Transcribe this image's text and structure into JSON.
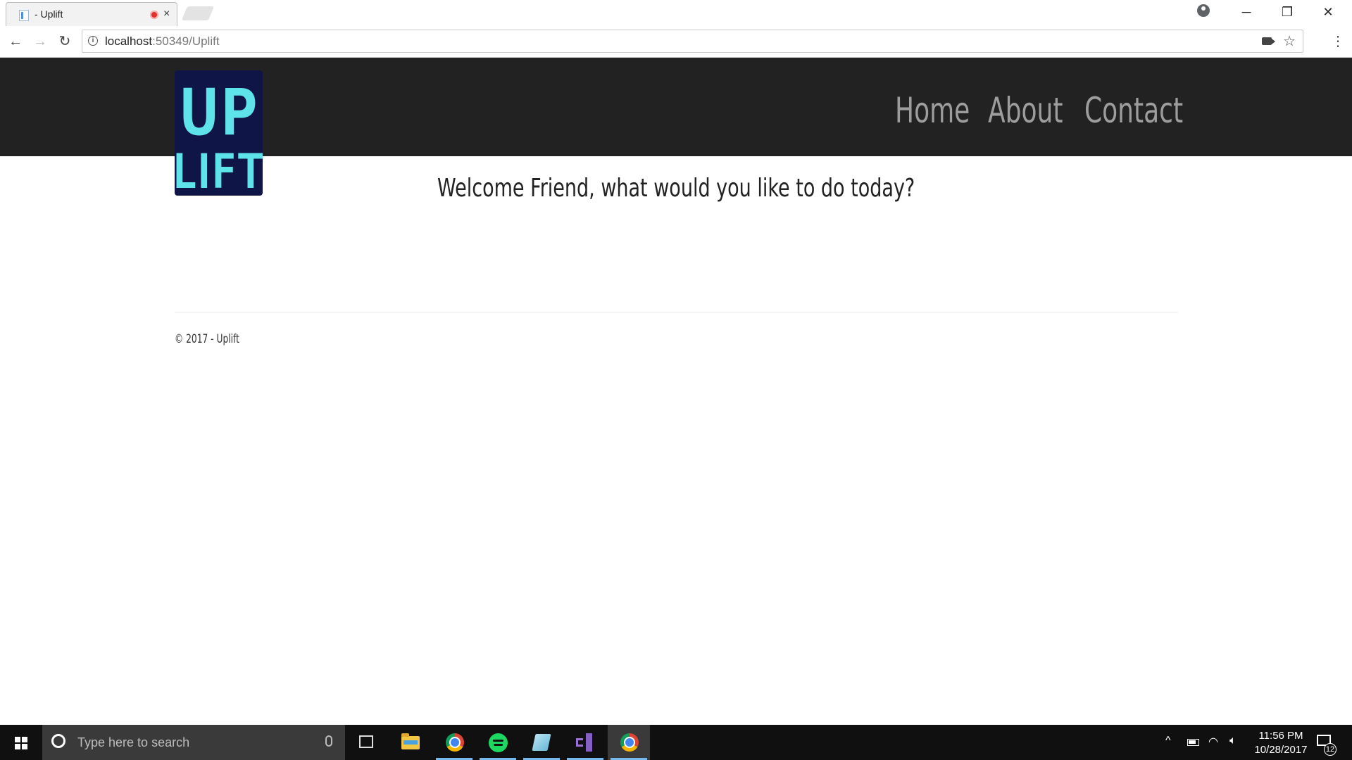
{
  "browser": {
    "tab_title": "- Uplift",
    "tab_close": "×",
    "url_host": "localhost",
    "url_rest": ":50349/Uplift",
    "window_controls": {
      "minimize": "─",
      "restore": "❐",
      "close": "✕"
    },
    "nav": {
      "back": "←",
      "forward": "→",
      "reload": "↻"
    },
    "star": "☆",
    "menu": "⋮"
  },
  "site": {
    "logo": {
      "line1": "UP",
      "line2": "LIFT",
      "fill": "#5fe3ea",
      "outline": "#0f1547"
    },
    "nav_items": [
      "Home",
      "About",
      "Contact"
    ],
    "welcome": "Welcome Friend, what would you like to do today?",
    "footer": "© 2017 - Uplift",
    "colors": {
      "header_bg": "#222222",
      "nav_text": "#9d9d9d"
    }
  },
  "taskbar": {
    "search_placeholder": "Type here to search",
    "time": "11:56 PM",
    "date": "10/28/2017",
    "notification_count": "12",
    "apps": [
      "task-view-icon",
      "file-explorer-icon",
      "chrome-icon",
      "spotify-icon",
      "notepad-icon",
      "visual-studio-icon",
      "chrome-icon"
    ]
  }
}
